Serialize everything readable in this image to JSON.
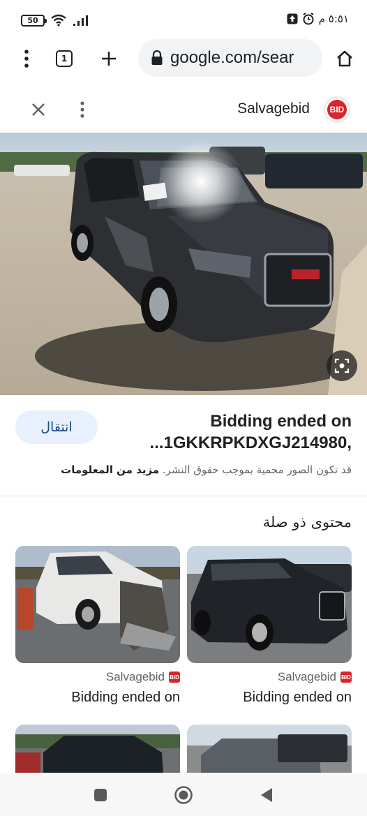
{
  "status_bar": {
    "battery": "50",
    "time": "٥:٥١ م",
    "icons": [
      "battery-icon",
      "wifi-icon",
      "signal-icon",
      "upload-icon",
      "alarm-icon"
    ]
  },
  "browser": {
    "tab_count": "1",
    "url": "google.com/sear",
    "icons": [
      "menu-icon",
      "tabs-icon",
      "new-tab-icon",
      "lock-icon",
      "home-icon"
    ]
  },
  "panel": {
    "site_name": "Salvagebid",
    "logo_text": "BID",
    "visit_label": "انتقال",
    "title_line1": "Bidding ended on",
    "title_line2": "...1GKKRPKDXGJ214980,",
    "copyright_text": "قد تكون الصور محمية بموجب حقوق النشر.",
    "more_info": "مزيد من المعلومات",
    "related_title": "محتوى ذو صلة"
  },
  "related": [
    {
      "source": "Salvagebid",
      "title": "Bidding ended on",
      "logo": "BID"
    },
    {
      "source": "Salvagebid",
      "title": "Bidding ended on",
      "logo": "BID"
    }
  ],
  "colors": {
    "brand_red": "#d8262b",
    "chip_bg": "#e8f0fe",
    "chip_text": "#1a4b8c"
  }
}
